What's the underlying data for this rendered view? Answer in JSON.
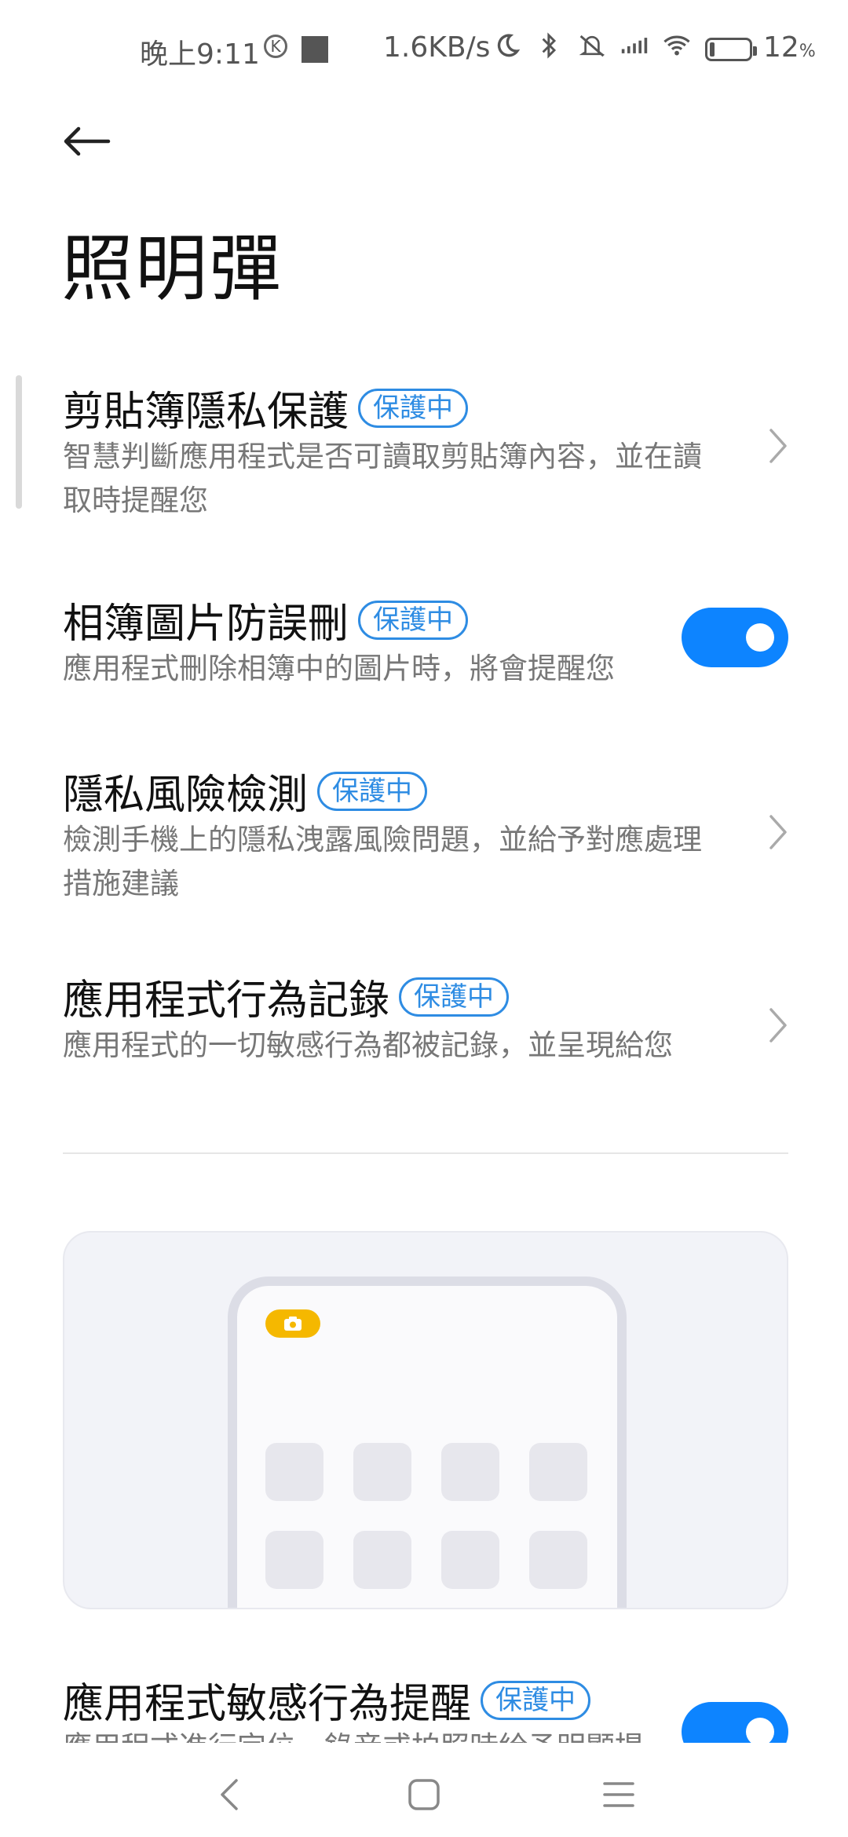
{
  "status_bar": {
    "time": "晚上9:11",
    "k_icon_label": "K",
    "net_speed": "1.6KB/s",
    "battery_level": "12",
    "battery_unit": "%",
    "icons": [
      "moon-icon",
      "bluetooth-icon",
      "silent-icon",
      "signal-icon",
      "wifi-icon",
      "battery-icon"
    ]
  },
  "header": {
    "title": "照明彈"
  },
  "settings": [
    {
      "title": "剪貼簿隱私保護",
      "badge": "保護中",
      "description": "智慧判斷應用程式是否可讀取剪貼簿內容，並在讀取時提醒您",
      "control": "chevron"
    },
    {
      "title": "相簿圖片防誤刪",
      "badge": "保護中",
      "description": "應用程式刪除相簿中的圖片時，將會提醒您",
      "control": "toggle",
      "enabled": true
    },
    {
      "title": "隱私風險檢測",
      "badge": "保護中",
      "description": "檢測手機上的隱私洩露風險問題，並給予對應處理措施建議",
      "control": "chevron"
    },
    {
      "title": "應用程式行為記錄",
      "badge": "保護中",
      "description": "應用程式的一切敏感行為都被記錄，並呈現給您",
      "control": "chevron"
    }
  ],
  "bottom_setting": {
    "title": "應用程式敏感行為提醒",
    "badge": "保護中",
    "description": "應用程式進行定位、錄音或拍照時給予明顯提",
    "control": "toggle",
    "enabled": true
  },
  "colors": {
    "accent": "#0d84ff",
    "badge": "#2e8ce3",
    "camera_indicator": "#f5b800"
  },
  "nav_bar": {
    "buttons": [
      "back-nav-icon",
      "home-nav-icon",
      "recents-nav-icon"
    ]
  }
}
